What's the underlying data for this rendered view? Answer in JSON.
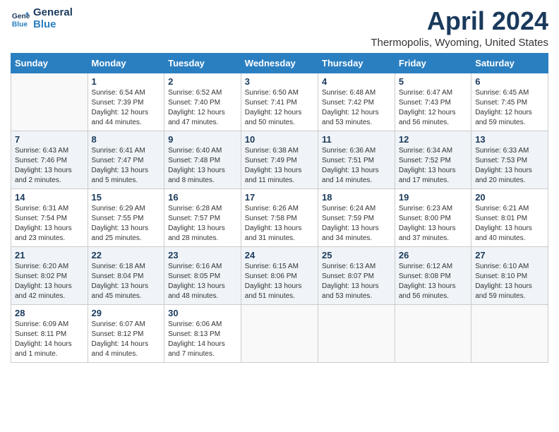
{
  "header": {
    "logo_line1": "General",
    "logo_line2": "Blue",
    "month": "April 2024",
    "location": "Thermopolis, Wyoming, United States"
  },
  "days_of_week": [
    "Sunday",
    "Monday",
    "Tuesday",
    "Wednesday",
    "Thursday",
    "Friday",
    "Saturday"
  ],
  "weeks": [
    [
      {
        "day": "",
        "sunrise": "",
        "sunset": "",
        "daylight": ""
      },
      {
        "day": "1",
        "sunrise": "Sunrise: 6:54 AM",
        "sunset": "Sunset: 7:39 PM",
        "daylight": "Daylight: 12 hours and 44 minutes."
      },
      {
        "day": "2",
        "sunrise": "Sunrise: 6:52 AM",
        "sunset": "Sunset: 7:40 PM",
        "daylight": "Daylight: 12 hours and 47 minutes."
      },
      {
        "day": "3",
        "sunrise": "Sunrise: 6:50 AM",
        "sunset": "Sunset: 7:41 PM",
        "daylight": "Daylight: 12 hours and 50 minutes."
      },
      {
        "day": "4",
        "sunrise": "Sunrise: 6:48 AM",
        "sunset": "Sunset: 7:42 PM",
        "daylight": "Daylight: 12 hours and 53 minutes."
      },
      {
        "day": "5",
        "sunrise": "Sunrise: 6:47 AM",
        "sunset": "Sunset: 7:43 PM",
        "daylight": "Daylight: 12 hours and 56 minutes."
      },
      {
        "day": "6",
        "sunrise": "Sunrise: 6:45 AM",
        "sunset": "Sunset: 7:45 PM",
        "daylight": "Daylight: 12 hours and 59 minutes."
      }
    ],
    [
      {
        "day": "7",
        "sunrise": "Sunrise: 6:43 AM",
        "sunset": "Sunset: 7:46 PM",
        "daylight": "Daylight: 13 hours and 2 minutes."
      },
      {
        "day": "8",
        "sunrise": "Sunrise: 6:41 AM",
        "sunset": "Sunset: 7:47 PM",
        "daylight": "Daylight: 13 hours and 5 minutes."
      },
      {
        "day": "9",
        "sunrise": "Sunrise: 6:40 AM",
        "sunset": "Sunset: 7:48 PM",
        "daylight": "Daylight: 13 hours and 8 minutes."
      },
      {
        "day": "10",
        "sunrise": "Sunrise: 6:38 AM",
        "sunset": "Sunset: 7:49 PM",
        "daylight": "Daylight: 13 hours and 11 minutes."
      },
      {
        "day": "11",
        "sunrise": "Sunrise: 6:36 AM",
        "sunset": "Sunset: 7:51 PM",
        "daylight": "Daylight: 13 hours and 14 minutes."
      },
      {
        "day": "12",
        "sunrise": "Sunrise: 6:34 AM",
        "sunset": "Sunset: 7:52 PM",
        "daylight": "Daylight: 13 hours and 17 minutes."
      },
      {
        "day": "13",
        "sunrise": "Sunrise: 6:33 AM",
        "sunset": "Sunset: 7:53 PM",
        "daylight": "Daylight: 13 hours and 20 minutes."
      }
    ],
    [
      {
        "day": "14",
        "sunrise": "Sunrise: 6:31 AM",
        "sunset": "Sunset: 7:54 PM",
        "daylight": "Daylight: 13 hours and 23 minutes."
      },
      {
        "day": "15",
        "sunrise": "Sunrise: 6:29 AM",
        "sunset": "Sunset: 7:55 PM",
        "daylight": "Daylight: 13 hours and 25 minutes."
      },
      {
        "day": "16",
        "sunrise": "Sunrise: 6:28 AM",
        "sunset": "Sunset: 7:57 PM",
        "daylight": "Daylight: 13 hours and 28 minutes."
      },
      {
        "day": "17",
        "sunrise": "Sunrise: 6:26 AM",
        "sunset": "Sunset: 7:58 PM",
        "daylight": "Daylight: 13 hours and 31 minutes."
      },
      {
        "day": "18",
        "sunrise": "Sunrise: 6:24 AM",
        "sunset": "Sunset: 7:59 PM",
        "daylight": "Daylight: 13 hours and 34 minutes."
      },
      {
        "day": "19",
        "sunrise": "Sunrise: 6:23 AM",
        "sunset": "Sunset: 8:00 PM",
        "daylight": "Daylight: 13 hours and 37 minutes."
      },
      {
        "day": "20",
        "sunrise": "Sunrise: 6:21 AM",
        "sunset": "Sunset: 8:01 PM",
        "daylight": "Daylight: 13 hours and 40 minutes."
      }
    ],
    [
      {
        "day": "21",
        "sunrise": "Sunrise: 6:20 AM",
        "sunset": "Sunset: 8:02 PM",
        "daylight": "Daylight: 13 hours and 42 minutes."
      },
      {
        "day": "22",
        "sunrise": "Sunrise: 6:18 AM",
        "sunset": "Sunset: 8:04 PM",
        "daylight": "Daylight: 13 hours and 45 minutes."
      },
      {
        "day": "23",
        "sunrise": "Sunrise: 6:16 AM",
        "sunset": "Sunset: 8:05 PM",
        "daylight": "Daylight: 13 hours and 48 minutes."
      },
      {
        "day": "24",
        "sunrise": "Sunrise: 6:15 AM",
        "sunset": "Sunset: 8:06 PM",
        "daylight": "Daylight: 13 hours and 51 minutes."
      },
      {
        "day": "25",
        "sunrise": "Sunrise: 6:13 AM",
        "sunset": "Sunset: 8:07 PM",
        "daylight": "Daylight: 13 hours and 53 minutes."
      },
      {
        "day": "26",
        "sunrise": "Sunrise: 6:12 AM",
        "sunset": "Sunset: 8:08 PM",
        "daylight": "Daylight: 13 hours and 56 minutes."
      },
      {
        "day": "27",
        "sunrise": "Sunrise: 6:10 AM",
        "sunset": "Sunset: 8:10 PM",
        "daylight": "Daylight: 13 hours and 59 minutes."
      }
    ],
    [
      {
        "day": "28",
        "sunrise": "Sunrise: 6:09 AM",
        "sunset": "Sunset: 8:11 PM",
        "daylight": "Daylight: 14 hours and 1 minute."
      },
      {
        "day": "29",
        "sunrise": "Sunrise: 6:07 AM",
        "sunset": "Sunset: 8:12 PM",
        "daylight": "Daylight: 14 hours and 4 minutes."
      },
      {
        "day": "30",
        "sunrise": "Sunrise: 6:06 AM",
        "sunset": "Sunset: 8:13 PM",
        "daylight": "Daylight: 14 hours and 7 minutes."
      },
      {
        "day": "",
        "sunrise": "",
        "sunset": "",
        "daylight": ""
      },
      {
        "day": "",
        "sunrise": "",
        "sunset": "",
        "daylight": ""
      },
      {
        "day": "",
        "sunrise": "",
        "sunset": "",
        "daylight": ""
      },
      {
        "day": "",
        "sunrise": "",
        "sunset": "",
        "daylight": ""
      }
    ]
  ]
}
